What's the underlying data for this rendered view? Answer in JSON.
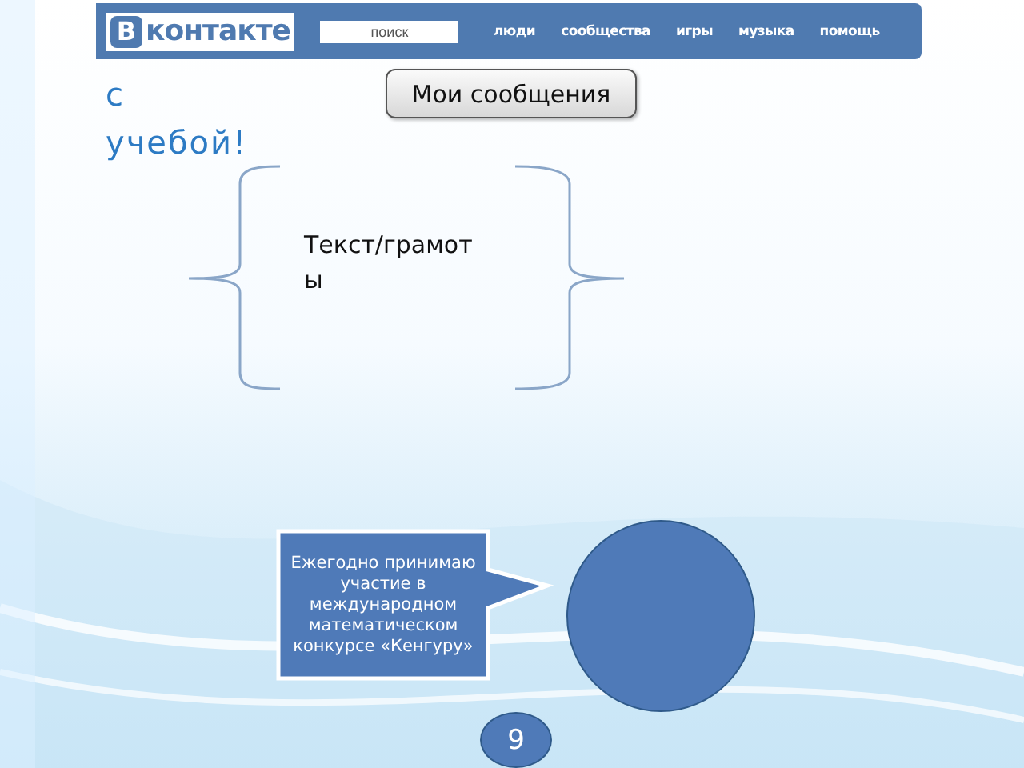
{
  "header": {
    "logo": {
      "badge": "В",
      "text": "контакте"
    },
    "search": {
      "placeholder": "поиск"
    },
    "nav": [
      "люди",
      "сообщества",
      "игры",
      "музыка",
      "помощь"
    ]
  },
  "heading_lines": [
    "с",
    "учебой!"
  ],
  "button": "Мои сообщения",
  "brace_text": "Текст/грамоты",
  "callout": "Ежегодно принимаю участие в международном математическом конкурсе «Кенгуру»",
  "page_number": "9"
}
